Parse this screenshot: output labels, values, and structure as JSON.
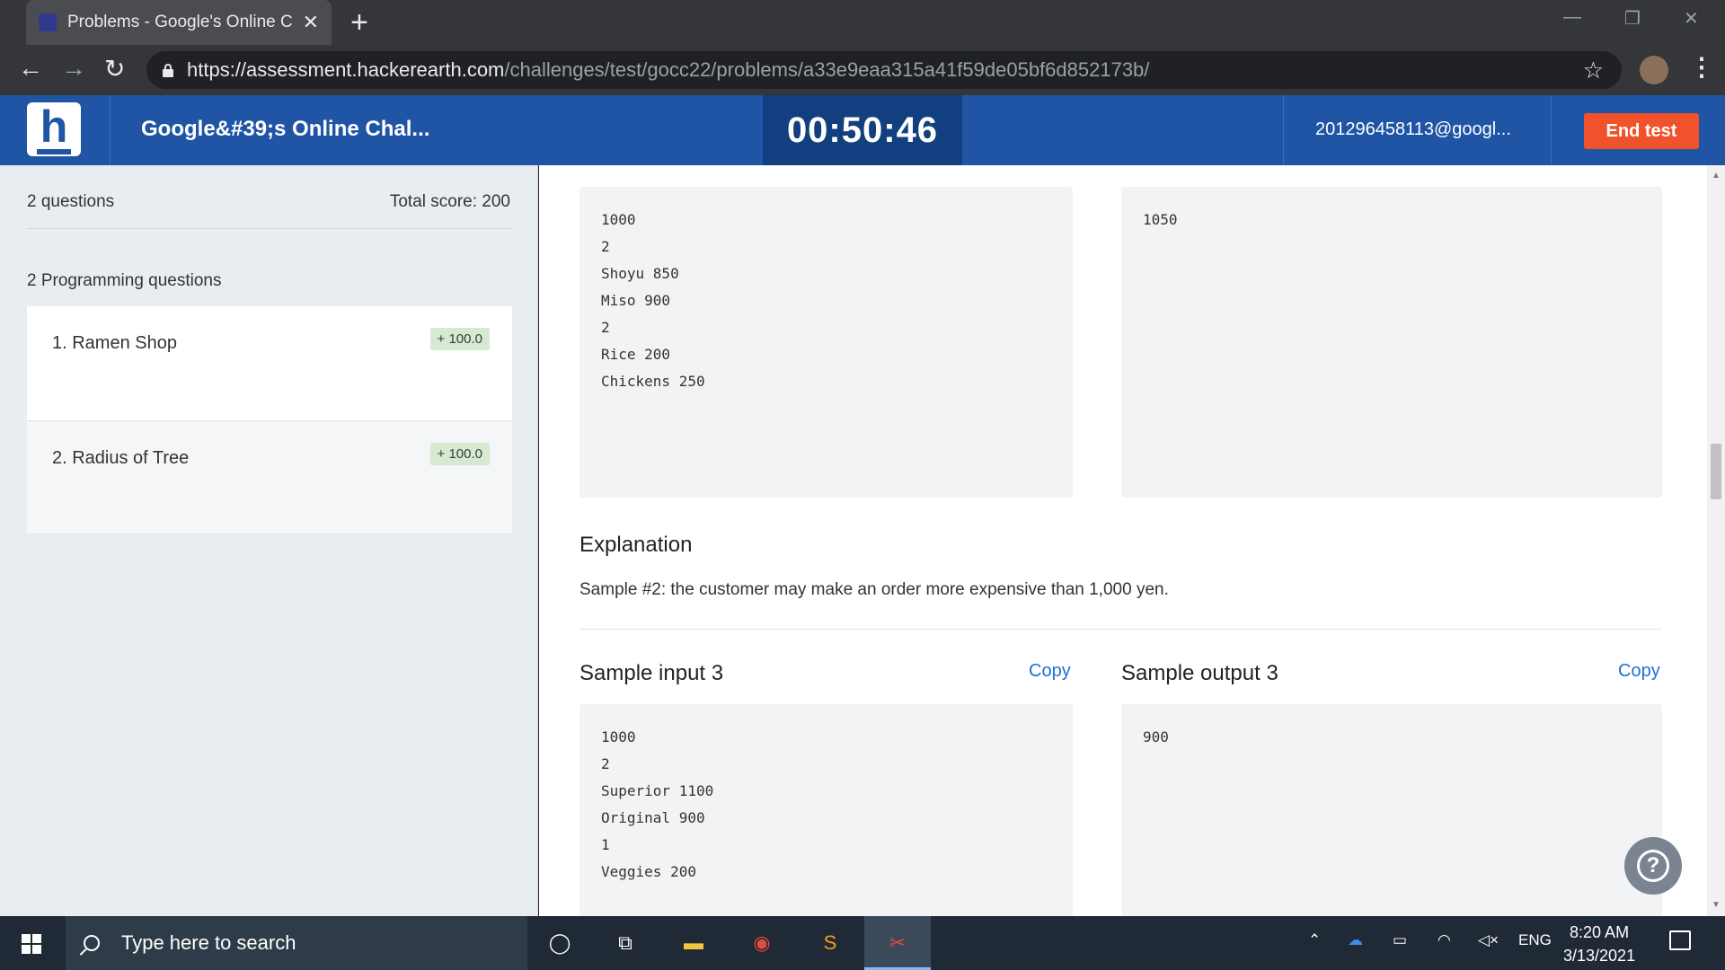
{
  "browser": {
    "tab_title": "Problems - Google's Online Chall",
    "url_host": "https://assessment.hackerearth.com",
    "url_path": "/challenges/test/gocc22/problems/a33e9eaa315a41f59de05bf6d852173b/"
  },
  "header": {
    "logo_letter": "h",
    "challenge_title": "Google&#39;s Online Chal...",
    "timer": "00:50:46",
    "user_email": "201296458113@googl...",
    "end_test_label": "End test"
  },
  "sidebar": {
    "questions_count": "2 questions",
    "total_score": "Total score: 200",
    "group_label": "2 Programming questions",
    "items": [
      {
        "label": "1.  Ramen Shop",
        "badge": "+ 100.0",
        "active": true
      },
      {
        "label": "2.  Radius of Tree",
        "badge": "+ 100.0",
        "active": false
      }
    ]
  },
  "main": {
    "sample2_input_lines": [
      "1000",
      "2",
      "Shoyu 850",
      "Miso 900",
      "2",
      "Rice 200",
      "Chickens 250"
    ],
    "sample2_output_lines": [
      "1050"
    ],
    "explanation_heading": "Explanation",
    "explanation_text": "Sample #2: the customer may make an order more expensive than 1,000 yen.",
    "sample3_input_heading": "Sample input 3",
    "sample3_output_heading": "Sample output 3",
    "copy_label": "Copy",
    "sample3_input_lines": [
      "1000",
      "2",
      "Superior 1100",
      "Original 900",
      "1",
      "Veggies 200"
    ],
    "sample3_output_lines": [
      "900"
    ],
    "help_label": "?"
  },
  "taskbar": {
    "search_placeholder": "Type here to search",
    "language": "ENG",
    "time": "8:20 AM",
    "date": "3/13/2021"
  }
}
